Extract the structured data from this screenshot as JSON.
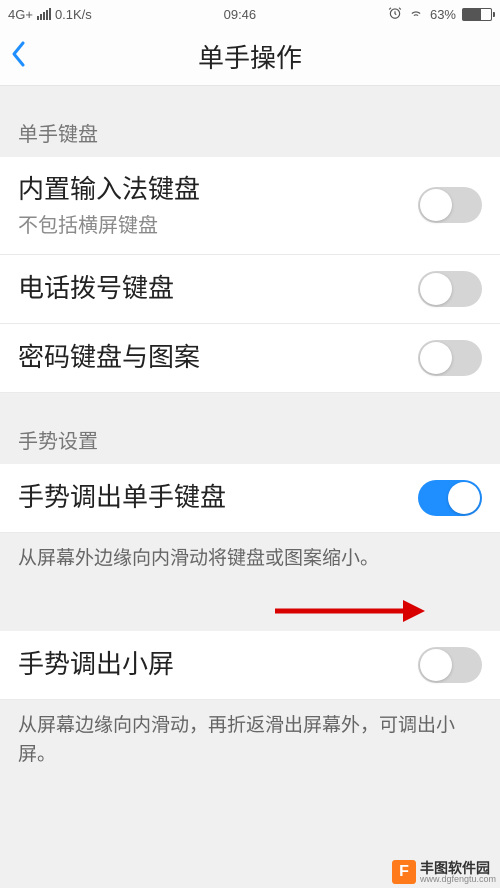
{
  "status": {
    "network": "4G+",
    "speed": "0.1K/s",
    "time": "09:46",
    "battery_pct": "63%"
  },
  "header": {
    "title": "单手操作"
  },
  "section1": {
    "header": "单手键盘",
    "items": [
      {
        "title": "内置输入法键盘",
        "subtitle": "不包括横屏键盘",
        "on": false
      },
      {
        "title": "电话拨号键盘",
        "on": false
      },
      {
        "title": "密码键盘与图案",
        "on": false
      }
    ]
  },
  "section2": {
    "header": "手势设置",
    "items": [
      {
        "title": "手势调出单手键盘",
        "on": true,
        "desc": "从屏幕外边缘向内滑动将键盘或图案缩小。"
      }
    ]
  },
  "section3": {
    "items": [
      {
        "title": "手势调出小屏",
        "on": false,
        "desc": "从屏幕边缘向内滑动，再折返滑出屏幕外，可调出小屏。"
      }
    ]
  },
  "watermark": {
    "logo_letter": "F",
    "name": "丰图软件园",
    "url": "www.dgfengtu.com"
  }
}
